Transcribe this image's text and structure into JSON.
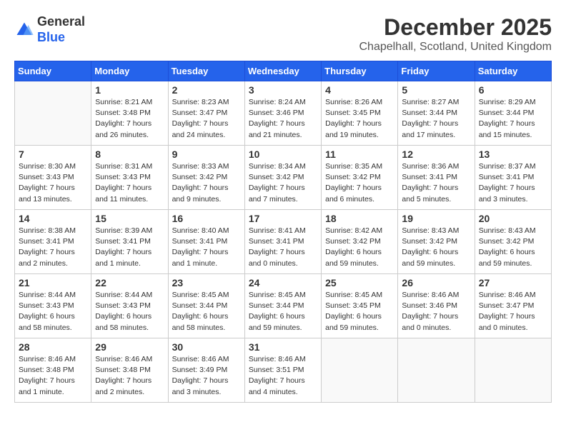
{
  "logo": {
    "general": "General",
    "blue": "Blue"
  },
  "header": {
    "month": "December 2025",
    "location": "Chapelhall, Scotland, United Kingdom"
  },
  "days_of_week": [
    "Sunday",
    "Monday",
    "Tuesday",
    "Wednesday",
    "Thursday",
    "Friday",
    "Saturday"
  ],
  "weeks": [
    [
      {
        "day": null,
        "info": null
      },
      {
        "day": "1",
        "info": "Sunrise: 8:21 AM\nSunset: 3:48 PM\nDaylight: 7 hours\nand 26 minutes."
      },
      {
        "day": "2",
        "info": "Sunrise: 8:23 AM\nSunset: 3:47 PM\nDaylight: 7 hours\nand 24 minutes."
      },
      {
        "day": "3",
        "info": "Sunrise: 8:24 AM\nSunset: 3:46 PM\nDaylight: 7 hours\nand 21 minutes."
      },
      {
        "day": "4",
        "info": "Sunrise: 8:26 AM\nSunset: 3:45 PM\nDaylight: 7 hours\nand 19 minutes."
      },
      {
        "day": "5",
        "info": "Sunrise: 8:27 AM\nSunset: 3:44 PM\nDaylight: 7 hours\nand 17 minutes."
      },
      {
        "day": "6",
        "info": "Sunrise: 8:29 AM\nSunset: 3:44 PM\nDaylight: 7 hours\nand 15 minutes."
      }
    ],
    [
      {
        "day": "7",
        "info": "Sunrise: 8:30 AM\nSunset: 3:43 PM\nDaylight: 7 hours\nand 13 minutes."
      },
      {
        "day": "8",
        "info": "Sunrise: 8:31 AM\nSunset: 3:43 PM\nDaylight: 7 hours\nand 11 minutes."
      },
      {
        "day": "9",
        "info": "Sunrise: 8:33 AM\nSunset: 3:42 PM\nDaylight: 7 hours\nand 9 minutes."
      },
      {
        "day": "10",
        "info": "Sunrise: 8:34 AM\nSunset: 3:42 PM\nDaylight: 7 hours\nand 7 minutes."
      },
      {
        "day": "11",
        "info": "Sunrise: 8:35 AM\nSunset: 3:42 PM\nDaylight: 7 hours\nand 6 minutes."
      },
      {
        "day": "12",
        "info": "Sunrise: 8:36 AM\nSunset: 3:41 PM\nDaylight: 7 hours\nand 5 minutes."
      },
      {
        "day": "13",
        "info": "Sunrise: 8:37 AM\nSunset: 3:41 PM\nDaylight: 7 hours\nand 3 minutes."
      }
    ],
    [
      {
        "day": "14",
        "info": "Sunrise: 8:38 AM\nSunset: 3:41 PM\nDaylight: 7 hours\nand 2 minutes."
      },
      {
        "day": "15",
        "info": "Sunrise: 8:39 AM\nSunset: 3:41 PM\nDaylight: 7 hours\nand 1 minute."
      },
      {
        "day": "16",
        "info": "Sunrise: 8:40 AM\nSunset: 3:41 PM\nDaylight: 7 hours\nand 1 minute."
      },
      {
        "day": "17",
        "info": "Sunrise: 8:41 AM\nSunset: 3:41 PM\nDaylight: 7 hours\nand 0 minutes."
      },
      {
        "day": "18",
        "info": "Sunrise: 8:42 AM\nSunset: 3:42 PM\nDaylight: 6 hours\nand 59 minutes."
      },
      {
        "day": "19",
        "info": "Sunrise: 8:43 AM\nSunset: 3:42 PM\nDaylight: 6 hours\nand 59 minutes."
      },
      {
        "day": "20",
        "info": "Sunrise: 8:43 AM\nSunset: 3:42 PM\nDaylight: 6 hours\nand 59 minutes."
      }
    ],
    [
      {
        "day": "21",
        "info": "Sunrise: 8:44 AM\nSunset: 3:43 PM\nDaylight: 6 hours\nand 58 minutes."
      },
      {
        "day": "22",
        "info": "Sunrise: 8:44 AM\nSunset: 3:43 PM\nDaylight: 6 hours\nand 58 minutes."
      },
      {
        "day": "23",
        "info": "Sunrise: 8:45 AM\nSunset: 3:44 PM\nDaylight: 6 hours\nand 58 minutes."
      },
      {
        "day": "24",
        "info": "Sunrise: 8:45 AM\nSunset: 3:44 PM\nDaylight: 6 hours\nand 59 minutes."
      },
      {
        "day": "25",
        "info": "Sunrise: 8:45 AM\nSunset: 3:45 PM\nDaylight: 6 hours\nand 59 minutes."
      },
      {
        "day": "26",
        "info": "Sunrise: 8:46 AM\nSunset: 3:46 PM\nDaylight: 7 hours\nand 0 minutes."
      },
      {
        "day": "27",
        "info": "Sunrise: 8:46 AM\nSunset: 3:47 PM\nDaylight: 7 hours\nand 0 minutes."
      }
    ],
    [
      {
        "day": "28",
        "info": "Sunrise: 8:46 AM\nSunset: 3:48 PM\nDaylight: 7 hours\nand 1 minute."
      },
      {
        "day": "29",
        "info": "Sunrise: 8:46 AM\nSunset: 3:48 PM\nDaylight: 7 hours\nand 2 minutes."
      },
      {
        "day": "30",
        "info": "Sunrise: 8:46 AM\nSunset: 3:49 PM\nDaylight: 7 hours\nand 3 minutes."
      },
      {
        "day": "31",
        "info": "Sunrise: 8:46 AM\nSunset: 3:51 PM\nDaylight: 7 hours\nand 4 minutes."
      },
      {
        "day": null,
        "info": null
      },
      {
        "day": null,
        "info": null
      },
      {
        "day": null,
        "info": null
      }
    ]
  ]
}
